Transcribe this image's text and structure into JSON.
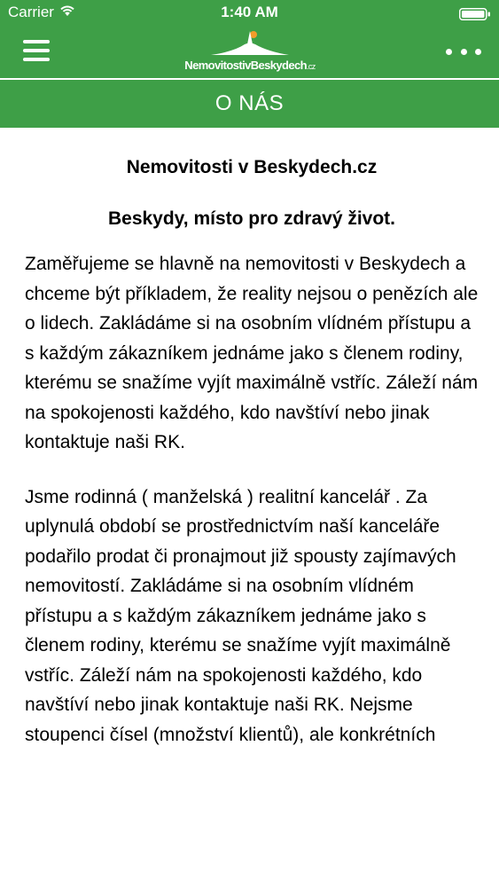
{
  "status_bar": {
    "carrier": "Carrier",
    "time": "1:40 AM",
    "icons": [
      "wifi-icon",
      "battery-icon"
    ]
  },
  "nav": {
    "menu_icon": "hamburger-menu-icon",
    "logo_text_main": "NemovitostivBeskydech",
    "logo_text_tld": ".cz",
    "more_icon": "more-options-icon"
  },
  "page": {
    "header": "O NÁS",
    "title": "Nemovitosti v Beskydech.cz",
    "subtitle": "Beskydy, místo pro zdravý život.",
    "paragraph_1": "Zaměřujeme se hlavně na nemovitosti v Beskydech a chceme být příkladem, že reality nejsou o penězích ale o lidech. Zakládáme si na osobním vlídném přístupu a s každým zákazníkem jednáme jako s členem rodiny, kterému se snažíme vyjít maximálně vstříc. Záleží nám na spokojenosti každého, kdo navštíví nebo jinak kontaktuje naši RK.",
    "paragraph_2": "Jsme rodinná ( manželská ) realitní kancelář . Za uplynulá období se prostřednictvím naší kanceláře podařilo prodat či pronajmout již spousty zajímavých nemovitostí. Zakládáme si na osobním vlídném přístupu a s každým zákazníkem jednáme jako s členem rodiny, kterému se snažíme vyjít maximálně vstříc. Záleží nám na spokojenosti každého, kdo navštíví nebo jinak kontaktuje naši RK. Nejsme stoupenci čísel (množství klientů), ale konkrétních"
  },
  "colors": {
    "brand_green": "#3e9f47",
    "logo_sun": "#f39c2a"
  }
}
